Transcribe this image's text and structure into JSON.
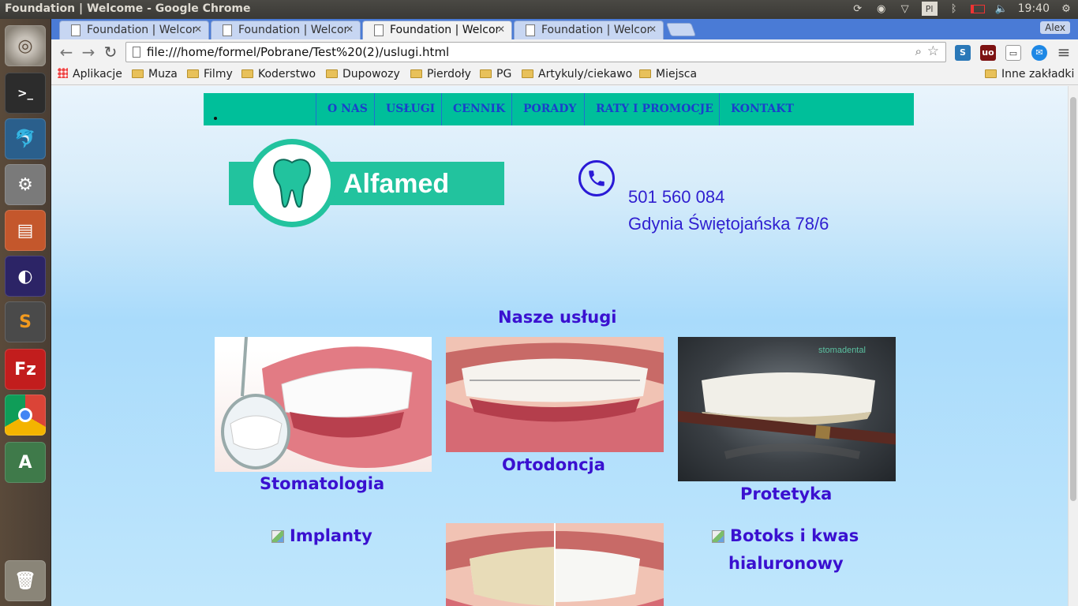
{
  "os": {
    "window_title": "Foundation | Welcome - Google Chrome",
    "keyboard_layout": "Pl",
    "clock": "19:40",
    "user": "Alex"
  },
  "browser": {
    "tabs": [
      {
        "label": "Foundation | Welcor",
        "active": false
      },
      {
        "label": "Foundation | Welcor",
        "active": false
      },
      {
        "label": "Foundation | Welcor",
        "active": true
      },
      {
        "label": "Foundation | Welcor",
        "active": false
      }
    ],
    "url": "file:///home/formel/Pobrane/Test%20(2)/uslugi.html",
    "bookmarks": [
      "Aplikacje",
      "Muza",
      "Filmy",
      "Koderstwo",
      "Dupowozy",
      "Pierdoły",
      "PG",
      "Artykuly/ciekawo",
      "Miejsca"
    ],
    "other_bookmarks": "Inne zakładki"
  },
  "site": {
    "nav": [
      "O NAS",
      "USŁUGI",
      "CENNIK",
      "PORADY",
      "RATY I PROMOCJE",
      "KONTAKT"
    ],
    "logo_text": "Alfamed",
    "phone": "501 560 084",
    "address": "Gdynia Świętojańska 78/6",
    "section_title": "Nasze usługi",
    "services": [
      "Stomatologia",
      "Ortodoncja",
      "Protetyka",
      "Implanty",
      "Botoks i kwas",
      "hialuronowy"
    ],
    "photo_watermark": "stomadental"
  },
  "colors": {
    "nav_bg": "#00bf9a",
    "nav_text": "#1a3fcc",
    "heading": "#3a10d0",
    "logo": "#22c39e"
  }
}
